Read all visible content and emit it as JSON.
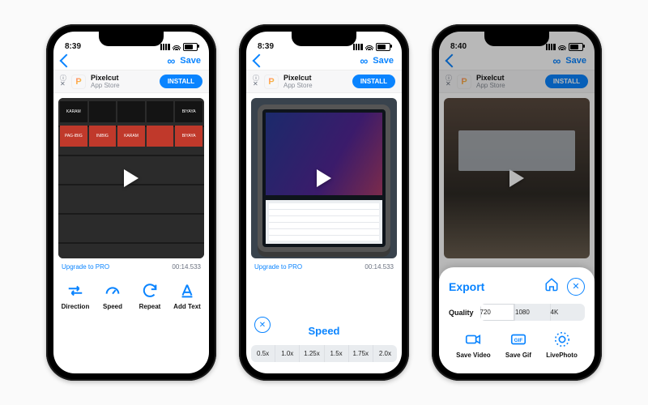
{
  "status": {
    "time1": "8:39",
    "time2": "8:40"
  },
  "nav": {
    "save": "Save",
    "loop": "∞"
  },
  "ad": {
    "name": "Pixelcut",
    "sub": "App Store",
    "cta": "INSTALL",
    "logo": "P",
    "close_top": "ⓘ",
    "close_bot": "✕"
  },
  "info": {
    "upgrade": "Upgrade to PRO",
    "time": "00:14.533"
  },
  "tools": [
    {
      "icon": "arrows",
      "label": "Direction"
    },
    {
      "icon": "gauge",
      "label": "Speed"
    },
    {
      "icon": "repeat",
      "label": "Repeat"
    },
    {
      "icon": "text",
      "label": "Add Text"
    }
  ],
  "speed": {
    "title": "Speed",
    "options": [
      "0.5x",
      "1.0x",
      "1.25x",
      "1.5x",
      "1.75x",
      "2.0x"
    ],
    "selected": "1.0x"
  },
  "export": {
    "title": "Export",
    "quality_label": "Quality",
    "quality_options": [
      "720",
      "1080",
      "4K"
    ],
    "quality_selected": "720",
    "actions": [
      {
        "icon": "video",
        "label": "Save Video"
      },
      {
        "icon": "gif",
        "label": "Save Gif"
      },
      {
        "icon": "live",
        "label": "LivePhoto"
      }
    ]
  },
  "preview_tiles": [
    "KARAM",
    "PAG-IBIG",
    "INIBIG",
    "KARAM",
    "BIYAYA"
  ]
}
